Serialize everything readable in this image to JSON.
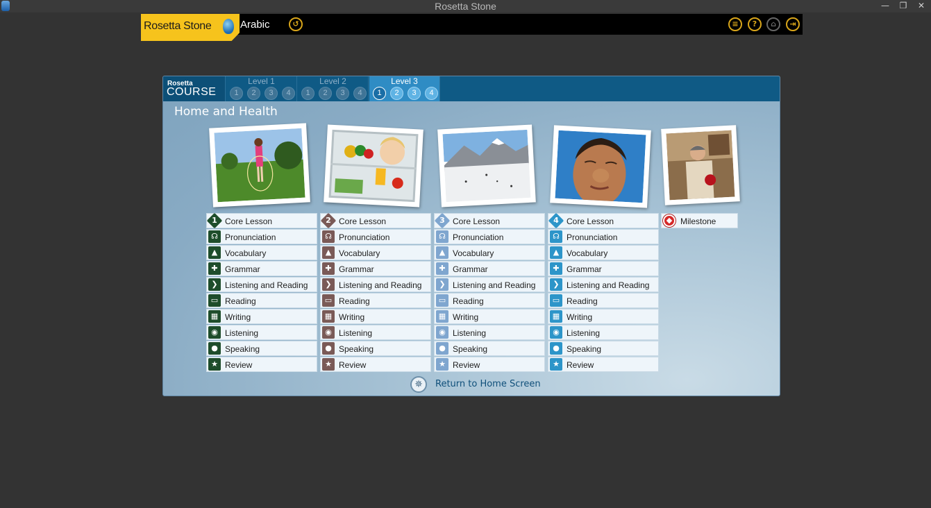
{
  "window": {
    "title": "Rosetta Stone",
    "controls": [
      "—",
      "❐",
      "✕"
    ]
  },
  "appbar": {
    "logo_text": "Rosetta Stone",
    "language": "Arabic",
    "icons": [
      "back-icon",
      "list-menu-icon",
      "help-icon",
      "home-icon",
      "exit-icon"
    ]
  },
  "course": {
    "logo_top": "Rosetta",
    "logo_bottom": "COURSE",
    "levels": [
      {
        "label": "Level 1",
        "units": [
          "1",
          "2",
          "3",
          "4"
        ],
        "active": false
      },
      {
        "label": "Level 2",
        "units": [
          "1",
          "2",
          "3",
          "4"
        ],
        "active": false
      },
      {
        "label": "Level 3",
        "units": [
          "1",
          "2",
          "3",
          "4"
        ],
        "active": true,
        "selected_unit": "1"
      }
    ],
    "unit_title": "Home and Health",
    "lesson_columns": [
      {
        "number": "1",
        "color": "#1e4d2b",
        "items": [
          "Core Lesson",
          "Pronunciation",
          "Vocabulary",
          "Grammar",
          "Listening and Reading",
          "Reading",
          "Writing",
          "Listening",
          "Speaking",
          "Review"
        ]
      },
      {
        "number": "2",
        "color": "#7a5a57",
        "items": [
          "Core Lesson",
          "Pronunciation",
          "Vocabulary",
          "Grammar",
          "Listening and Reading",
          "Reading",
          "Writing",
          "Listening",
          "Speaking",
          "Review"
        ]
      },
      {
        "number": "3",
        "color": "#7fa6cf",
        "items": [
          "Core Lesson",
          "Pronunciation",
          "Vocabulary",
          "Grammar",
          "Listening and Reading",
          "Reading",
          "Writing",
          "Listening",
          "Speaking",
          "Review"
        ]
      },
      {
        "number": "4",
        "color": "#2d95c9",
        "items": [
          "Core Lesson",
          "Pronunciation",
          "Vocabulary",
          "Grammar",
          "Listening and Reading",
          "Reading",
          "Writing",
          "Listening",
          "Speaking",
          "Review"
        ]
      }
    ],
    "milestone_label": "Milestone",
    "return_label": "Return to Home Screen"
  }
}
